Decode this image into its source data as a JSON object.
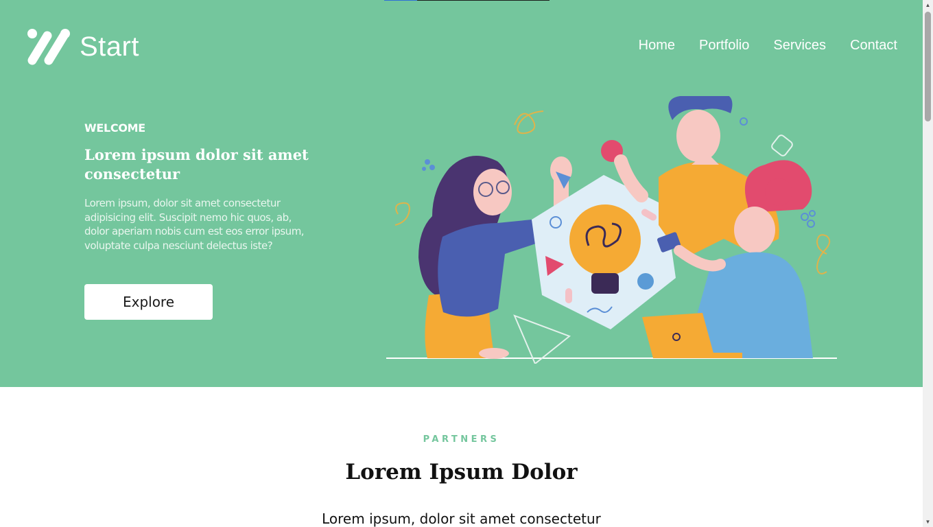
{
  "logo": {
    "text": "Start",
    "icon": "logo-mark-icon"
  },
  "nav": {
    "items": [
      "Home",
      "Portfolio",
      "Services",
      "Contact"
    ]
  },
  "hero": {
    "eyebrow": "WELCOME",
    "title": "Lorem ipsum dolor sit amet consectetur",
    "description": "Lorem ipsum, dolor sit amet consectetur adipisicing elit. Suscipit nemo hic quos, ab, dolor aperiam nobis cum est eos error ipsum, voluptate culpa nesciunt delectus iste?",
    "button_label": "Explore",
    "illustration": "team-brainstorm-illustration"
  },
  "partners": {
    "label": "PARTNERS",
    "title": "Lorem Ipsum Dolor",
    "text": "Lorem ipsum, dolor sit amet consectetur"
  },
  "colors": {
    "hero_bg": "#74c69d",
    "accent": "#74c69d",
    "progress": "#2f6fd6"
  }
}
